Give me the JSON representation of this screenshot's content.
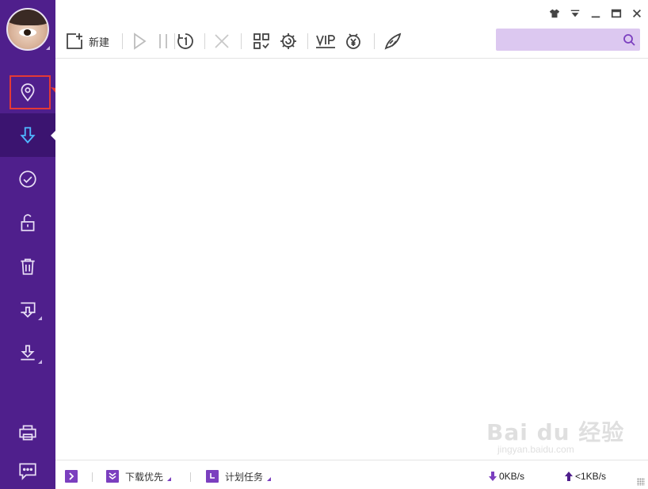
{
  "toolbar": {
    "new_label": "新建",
    "search_placeholder": ""
  },
  "statusbar": {
    "download_priority": "下载优先",
    "schedule_task": "计划任务",
    "down_speed": "0KB/s",
    "up_speed": "<1KB/s"
  },
  "watermark": {
    "logo": "Bai du 经验",
    "sub": "jingyan.baidu.com"
  },
  "colors": {
    "sidebar": "#4f1f8c",
    "sidebar_active": "#3b1470",
    "accent": "#7b3fbf",
    "search_bg": "#dcc8f0",
    "annotation": "#e53935"
  },
  "icons": {
    "sidebar": [
      "location-pin-icon",
      "download-arrow-icon",
      "check-circle-icon",
      "unlock-icon",
      "trash-icon",
      "monitor-download-icon",
      "tray-download-icon",
      "printer-icon",
      "chat-icon"
    ],
    "toolbar": [
      "new-file-icon",
      "play-icon",
      "pause-icon",
      "speed-limit-icon",
      "delete-x-icon",
      "app-grid-icon",
      "settings-gear-icon",
      "vip-icon",
      "yen-piggy-icon",
      "rocket-icon",
      "search-icon"
    ],
    "window": [
      "skin-shirt-icon",
      "menu-icon",
      "minimize-icon",
      "maximize-icon",
      "close-icon"
    ]
  }
}
